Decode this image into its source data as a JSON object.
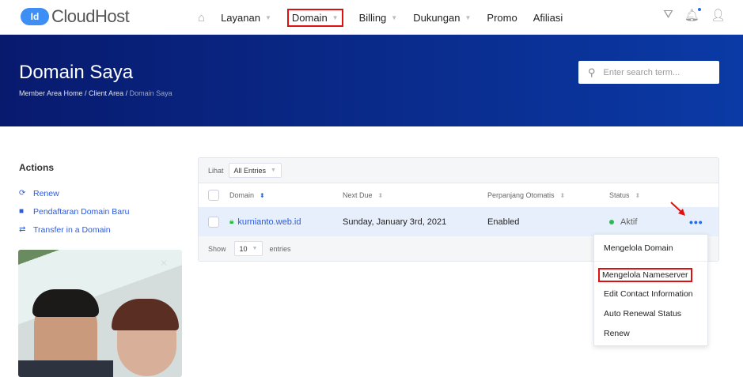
{
  "brand": {
    "badge": "Id",
    "name": "CloudHost"
  },
  "nav": {
    "items": [
      "Layanan",
      "Domain",
      "Billing",
      "Dukungan",
      "Promo",
      "Afiliasi"
    ]
  },
  "banner": {
    "title": "Domain Saya",
    "breadcrumb": [
      "Member Area Home",
      "Client Area",
      "Domain Saya"
    ],
    "search_placeholder": "Enter search term..."
  },
  "actions": {
    "title": "Actions",
    "items": [
      "Renew",
      "Pendaftaran Domain Baru",
      "Transfer in a Domain"
    ]
  },
  "table": {
    "filter_label": "Lihat",
    "filter_value": "All Entries",
    "columns": [
      "Domain",
      "Next Due",
      "Perpanjang Otomatis",
      "Status"
    ],
    "rows": [
      {
        "domain": "kurnianto.web.id",
        "next_due": "Sunday, January 3rd, 2021",
        "auto_renew": "Enabled",
        "status": "Aktif"
      }
    ],
    "show_label": "Show",
    "page_size": "10",
    "entries_label": "entries"
  },
  "menu": {
    "items": [
      "Mengelola Domain",
      "Mengelola Nameserver",
      "Edit Contact Information",
      "Auto Renewal Status",
      "Renew"
    ]
  },
  "colors": {
    "accent": "#2a5ae0",
    "highlight": "#e01010",
    "banner": "#0b2a8f"
  }
}
